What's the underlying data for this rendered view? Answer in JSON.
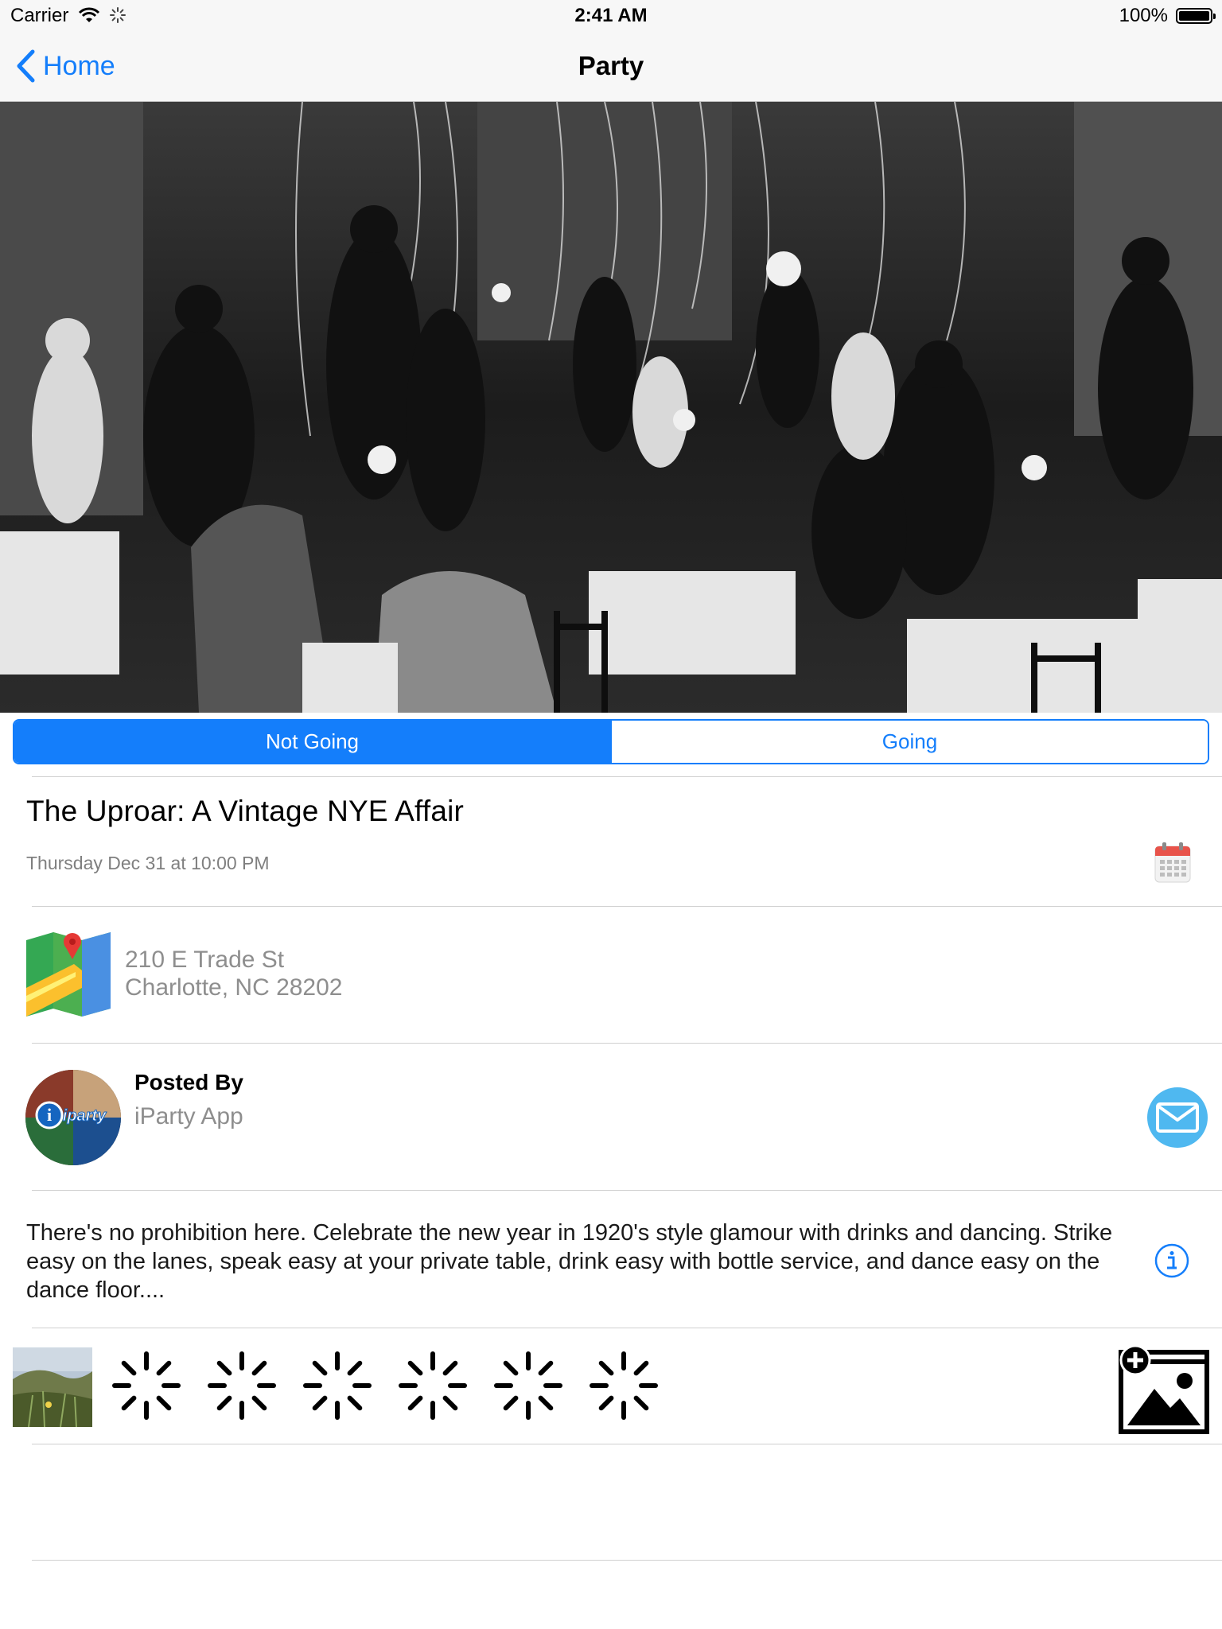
{
  "status_bar": {
    "carrier": "Carrier",
    "time": "2:41 AM",
    "battery": "100%"
  },
  "nav": {
    "back_label": "Home",
    "title": "Party"
  },
  "rsvp": {
    "options": [
      "Not Going",
      "Going"
    ],
    "selected": "Not Going"
  },
  "event": {
    "title": "The Uproar: A Vintage NYE Affair",
    "date": "Thursday Dec 31 at 10:00 PM",
    "address_line1": "210 E Trade St",
    "address_line2": "Charlotte, NC 28202"
  },
  "poster": {
    "label": "Posted By",
    "name": "iParty App",
    "avatar_text": "iparty"
  },
  "description": "There's no prohibition here. Celebrate the new year in 1920's style glamour with drinks and dancing. Strike easy on the lanes, speak easy at your private table, drink easy with bottle service, and dance easy on the dance floor....",
  "photos": {
    "loading_count": 6
  },
  "icons": {
    "back": "chevron-left-icon",
    "calendar": "calendar-icon",
    "map": "map-icon",
    "mail": "mail-icon",
    "info": "info-icon",
    "add_photo": "add-photo-icon",
    "loading": "loading-spinner-icon"
  },
  "colors": {
    "accent": "#147efb",
    "secondary_text": "#8e8e8e",
    "mail_button": "#4fb8f0",
    "calendar_red": "#e8534a"
  }
}
